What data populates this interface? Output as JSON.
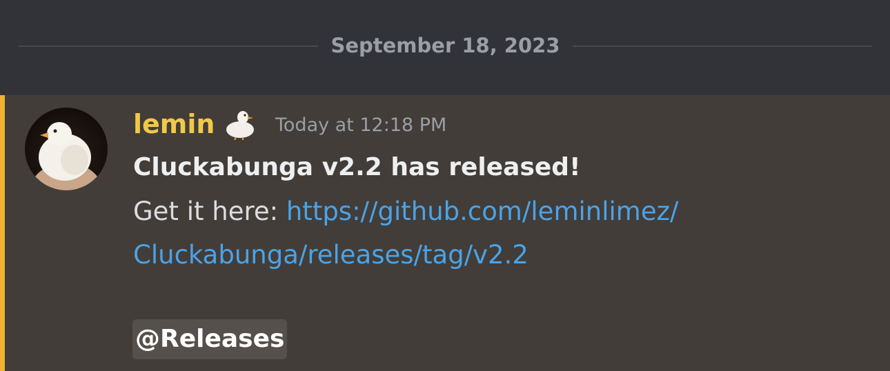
{
  "divider": {
    "date": "September 18, 2023"
  },
  "message": {
    "author": "lemin",
    "badge_icon": "duck-icon",
    "timestamp": "Today at 12:18 PM",
    "headline": "Cluckabunga v2.2 has released!",
    "prefix": "Get it here: ",
    "link_line1": "https://github.com/leminlimez/",
    "link_line2": "Cluckabunga/releases/tag/v2.2",
    "mention": "@Releases"
  },
  "colors": {
    "background": "#313338",
    "mention_highlight": "#423d38",
    "mention_bar": "#f0b232",
    "author": "#f0c94a",
    "link": "#4aa3e8"
  }
}
